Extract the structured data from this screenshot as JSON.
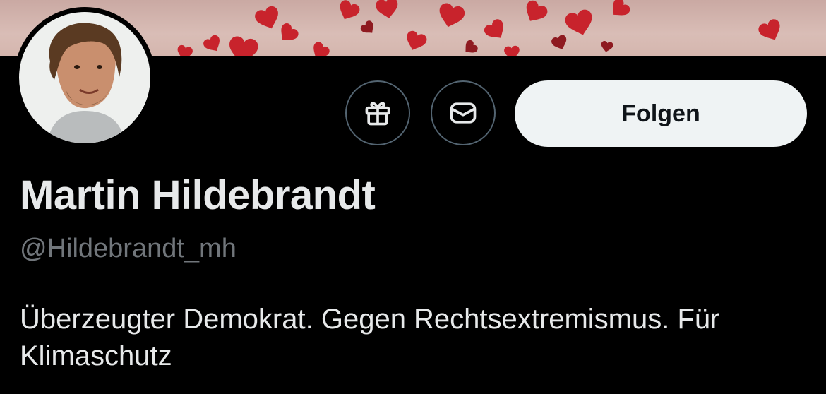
{
  "profile": {
    "display_name": "Martin Hildebrandt",
    "handle": "@Hildebrandt_mh",
    "bio": "Überzeugter Demokrat. Gegen Rechtsextremismus. Für Klimaschutz"
  },
  "actions": {
    "gift_icon": "gift-icon",
    "message_icon": "envelope-icon",
    "follow_label": "Folgen"
  },
  "colors": {
    "background": "#000000",
    "primary_text": "#e7e9ea",
    "secondary_text": "#71767b",
    "button_border": "#536471",
    "follow_bg": "#eff3f4",
    "follow_text": "#0f1419",
    "banner_hearts": "#c8232c"
  }
}
